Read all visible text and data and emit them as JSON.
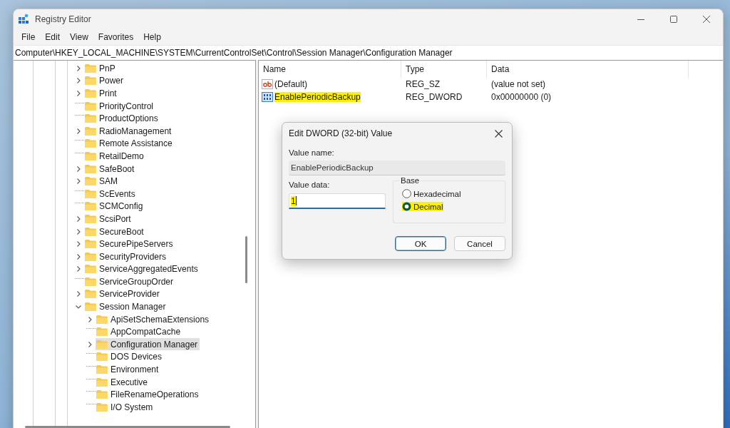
{
  "window": {
    "title": "Registry Editor"
  },
  "menu": [
    "File",
    "Edit",
    "View",
    "Favorites",
    "Help"
  ],
  "address": "Computer\\HKEY_LOCAL_MACHINE\\SYSTEM\\CurrentControlSet\\Control\\Session Manager\\Configuration Manager",
  "tree": [
    {
      "label": "PnP",
      "expandable": true,
      "expanded": false,
      "selected": false
    },
    {
      "label": "Power",
      "expandable": true,
      "expanded": false,
      "selected": false
    },
    {
      "label": "Print",
      "expandable": true,
      "expanded": false,
      "selected": false
    },
    {
      "label": "PriorityControl",
      "expandable": false,
      "selected": false
    },
    {
      "label": "ProductOptions",
      "expandable": false,
      "selected": false
    },
    {
      "label": "RadioManagement",
      "expandable": true,
      "expanded": false,
      "selected": false
    },
    {
      "label": "Remote Assistance",
      "expandable": false,
      "selected": false
    },
    {
      "label": "RetailDemo",
      "expandable": false,
      "selected": false
    },
    {
      "label": "SafeBoot",
      "expandable": true,
      "expanded": false,
      "selected": false
    },
    {
      "label": "SAM",
      "expandable": true,
      "expanded": false,
      "selected": false
    },
    {
      "label": "ScEvents",
      "expandable": false,
      "selected": false
    },
    {
      "label": "SCMConfig",
      "expandable": false,
      "selected": false
    },
    {
      "label": "ScsiPort",
      "expandable": true,
      "expanded": false,
      "selected": false
    },
    {
      "label": "SecureBoot",
      "expandable": true,
      "expanded": false,
      "selected": false
    },
    {
      "label": "SecurePipeServers",
      "expandable": true,
      "expanded": false,
      "selected": false
    },
    {
      "label": "SecurityProviders",
      "expandable": true,
      "expanded": false,
      "selected": false
    },
    {
      "label": "ServiceAggregatedEvents",
      "expandable": true,
      "expanded": false,
      "selected": false
    },
    {
      "label": "ServiceGroupOrder",
      "expandable": false,
      "selected": false
    },
    {
      "label": "ServiceProvider",
      "expandable": true,
      "expanded": false,
      "selected": false
    },
    {
      "label": "Session Manager",
      "expandable": true,
      "expanded": true,
      "selected": false,
      "children": [
        {
          "label": "ApiSetSchemaExtensions",
          "expandable": true,
          "expanded": false,
          "selected": false
        },
        {
          "label": "AppCompatCache",
          "expandable": false,
          "selected": false
        },
        {
          "label": "Configuration Manager",
          "expandable": true,
          "expanded": false,
          "selected": true
        },
        {
          "label": "DOS Devices",
          "expandable": false,
          "selected": false
        },
        {
          "label": "Environment",
          "expandable": false,
          "selected": false
        },
        {
          "label": "Executive",
          "expandable": false,
          "selected": false
        },
        {
          "label": "FileRenameOperations",
          "expandable": false,
          "selected": false
        },
        {
          "label": "I/O System",
          "expandable": false,
          "selected": false
        }
      ]
    }
  ],
  "values": {
    "columns": [
      "Name",
      "Type",
      "Data"
    ],
    "rows": [
      {
        "kind": "string",
        "name": "(Default)",
        "type": "REG_SZ",
        "data": "(value not set)",
        "highlighted": false
      },
      {
        "kind": "dword",
        "name": "EnablePeriodicBackup",
        "type": "REG_DWORD",
        "data": "0x00000000 (0)",
        "highlighted": true
      }
    ]
  },
  "dialog": {
    "title": "Edit DWORD (32-bit) Value",
    "value_name_label": "Value name:",
    "value_name": "EnablePeriodicBackup",
    "value_data_label": "Value data:",
    "value_data": "1",
    "value_data_highlighted": true,
    "base_label": "Base",
    "bases": [
      {
        "label": "Hexadecimal",
        "selected": false,
        "highlighted": false
      },
      {
        "label": "Decimal",
        "selected": true,
        "highlighted": true
      }
    ],
    "buttons": [
      {
        "label": "OK",
        "default": true
      },
      {
        "label": "Cancel",
        "default": false
      }
    ]
  }
}
